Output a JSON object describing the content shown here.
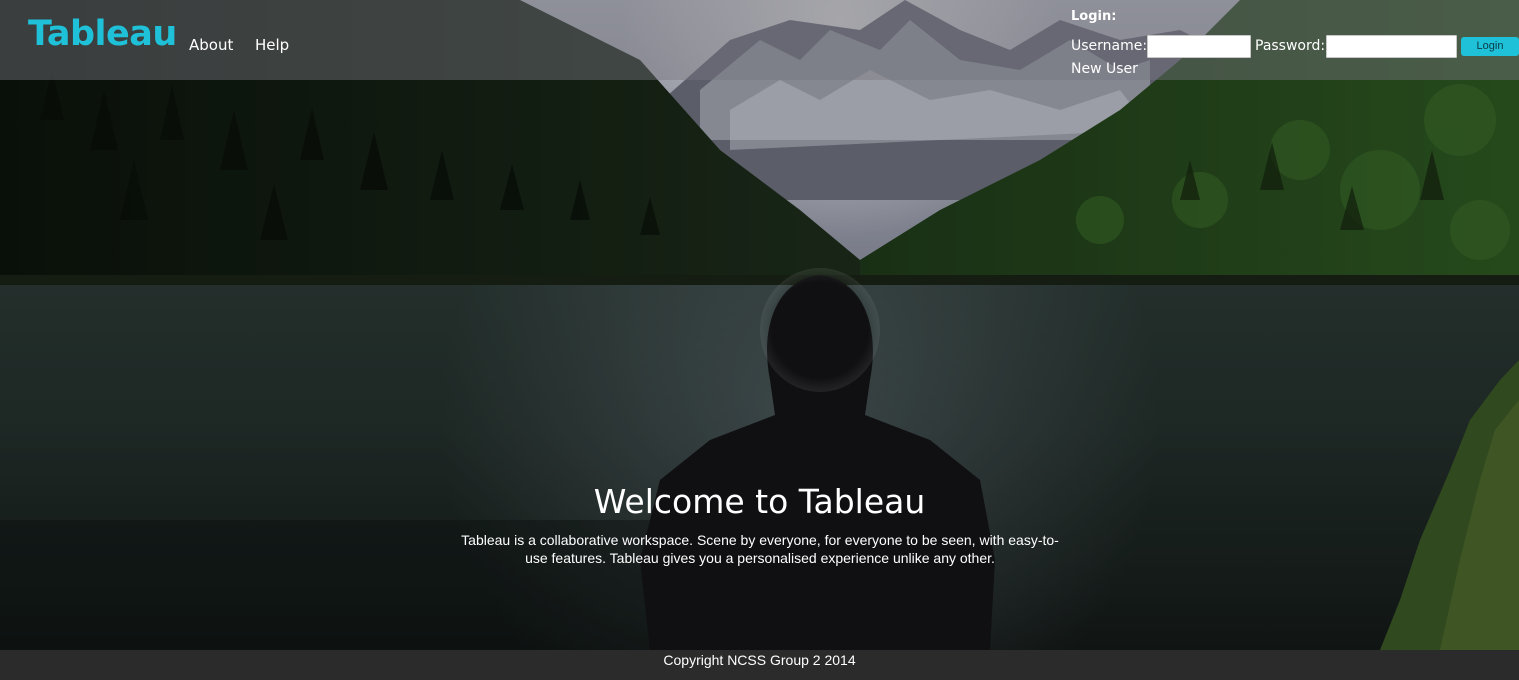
{
  "header": {
    "brand": "Tableau",
    "nav": {
      "about": "About",
      "help": "Help"
    },
    "login": {
      "title": "Login:",
      "username_label": "Username:",
      "username_value": "",
      "password_label": "Password:",
      "password_value": "",
      "button_label": "Login",
      "new_user_link": "New User"
    }
  },
  "hero": {
    "title": "Welcome to Tableau",
    "description": "Tableau is a collaborative workspace. Scene by everyone, for everyone to be seen, with easy-to-use features. Tableau gives you a personalised experience unlike any other."
  },
  "footer": {
    "copyright": "Copyright NCSS Group 2 2014"
  },
  "colors": {
    "brand_accent": "#1fc1d8",
    "header_overlay": "#606068",
    "footer_bg": "#2b2b2b"
  }
}
